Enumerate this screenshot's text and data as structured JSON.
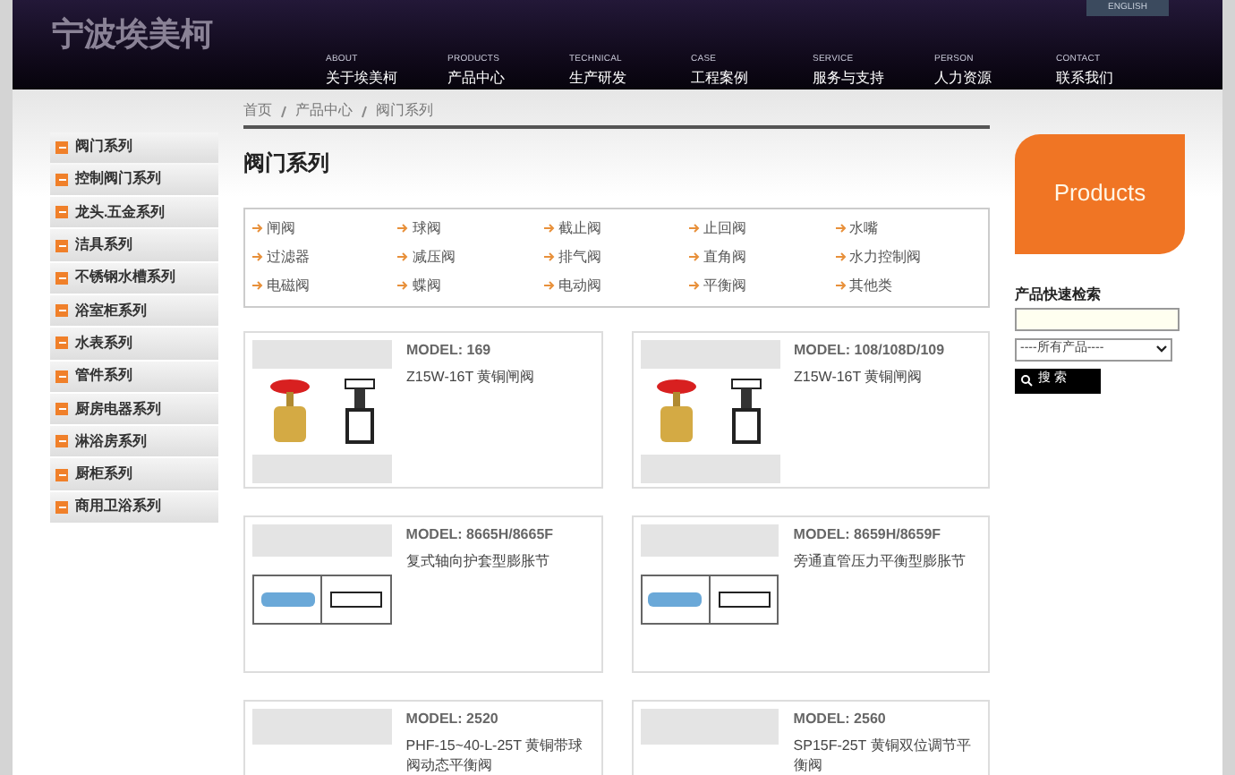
{
  "header": {
    "logo": "宁波埃美柯",
    "language": "ENGLISH",
    "nav": [
      {
        "en": "ABOUT",
        "zh": "关于埃美柯"
      },
      {
        "en": "PRODUCTS",
        "zh": "产品中心"
      },
      {
        "en": "TECHNICAL",
        "zh": "生产研发"
      },
      {
        "en": "CASE",
        "zh": "工程案例"
      },
      {
        "en": "SERVICE",
        "zh": "服务与支持"
      },
      {
        "en": "PERSON",
        "zh": "人力资源"
      },
      {
        "en": "CONTACT",
        "zh": "联系我们"
      }
    ]
  },
  "sidebar": {
    "items": [
      "阀门系列",
      "控制阀门系列",
      "龙头.五金系列",
      "洁具系列",
      "不锈钢水槽系列",
      "浴室柜系列",
      "水表系列",
      "管件系列",
      "厨房电器系列",
      "淋浴房系列",
      "厨柜系列",
      "商用卫浴系列"
    ]
  },
  "breadcrumb": [
    "首页",
    "产品中心",
    "阀门系列"
  ],
  "page_title": "阀门系列",
  "categories": [
    "闸阀",
    "球阀",
    "截止阀",
    "止回阀",
    "水嘴",
    "过滤器",
    "减压阀",
    "排气阀",
    "直角阀",
    "水力控制阀",
    "电磁阀",
    "蝶阀",
    "电动阀",
    "平衡阀",
    "其他类"
  ],
  "products": [
    {
      "kind": "valve",
      "model": "MODEL: 169",
      "name": "Z15W-16T 黄铜闸阀"
    },
    {
      "kind": "valve",
      "model": "MODEL: 108/108D/109",
      "name": "Z15W-16T 黄铜闸阀"
    },
    {
      "kind": "joint",
      "model": "MODEL: 8665H/8665F",
      "name": "复式轴向护套型膨胀节"
    },
    {
      "kind": "joint",
      "model": "MODEL: 8659H/8659F",
      "name": "旁通直管压力平衡型膨胀节"
    },
    {
      "kind": "other",
      "model": "MODEL: 2520",
      "name": "PHF-15~40-L-25T 黄铜带球阀动态平衡阀"
    },
    {
      "kind": "other",
      "model": "MODEL: 2560",
      "name": "SP15F-25T 黄铜双位调节平衡阀"
    }
  ],
  "right": {
    "banner": "Products",
    "search_label": "产品快速检索",
    "select_value": "----所有产品----",
    "search_button": "搜 索"
  }
}
